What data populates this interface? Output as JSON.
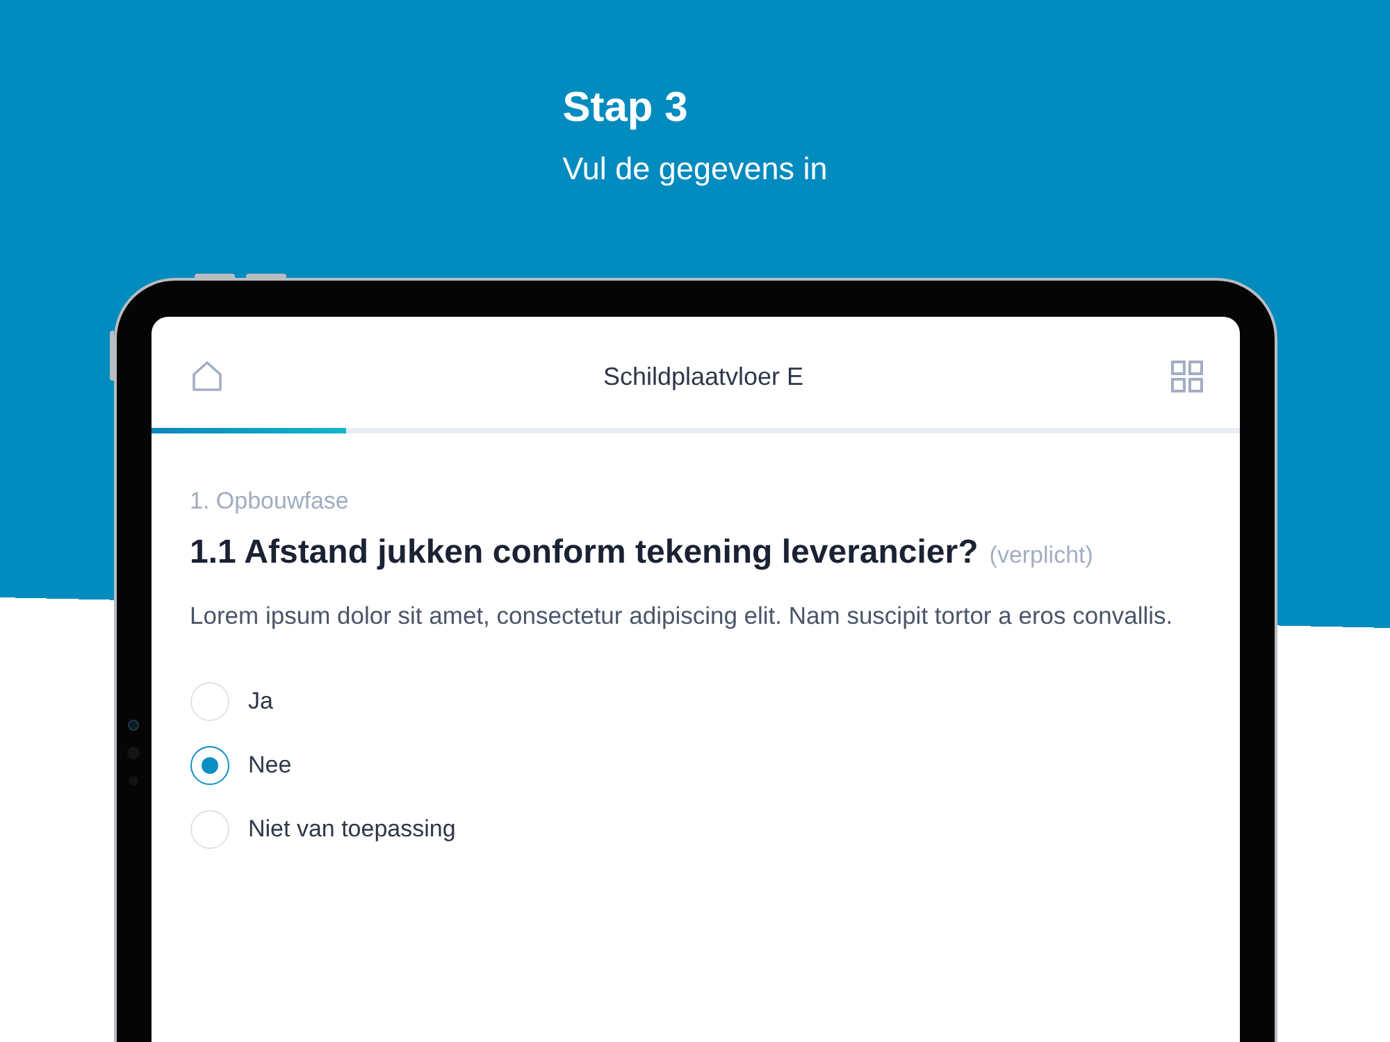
{
  "intro": {
    "title": "Stap 3",
    "subtitle": "Vul de gegevens in"
  },
  "app": {
    "title": "Schildplaatvloer E",
    "progress": {
      "level": 0.18
    }
  },
  "section": "1. Opbouwfase",
  "question": {
    "title": "1.1 Afstand jukken conform tekening leverancier?",
    "required_note": "(verplicht)",
    "description": "Lorem ipsum dolor sit amet, consectetur adipiscing elit. Nam suscipit tortor a eros convallis.",
    "options": [
      {
        "label": "Ja",
        "selected": false
      },
      {
        "label": "Nee",
        "selected": true
      },
      {
        "label": "Niet van toepassing",
        "selected": false
      }
    ]
  }
}
